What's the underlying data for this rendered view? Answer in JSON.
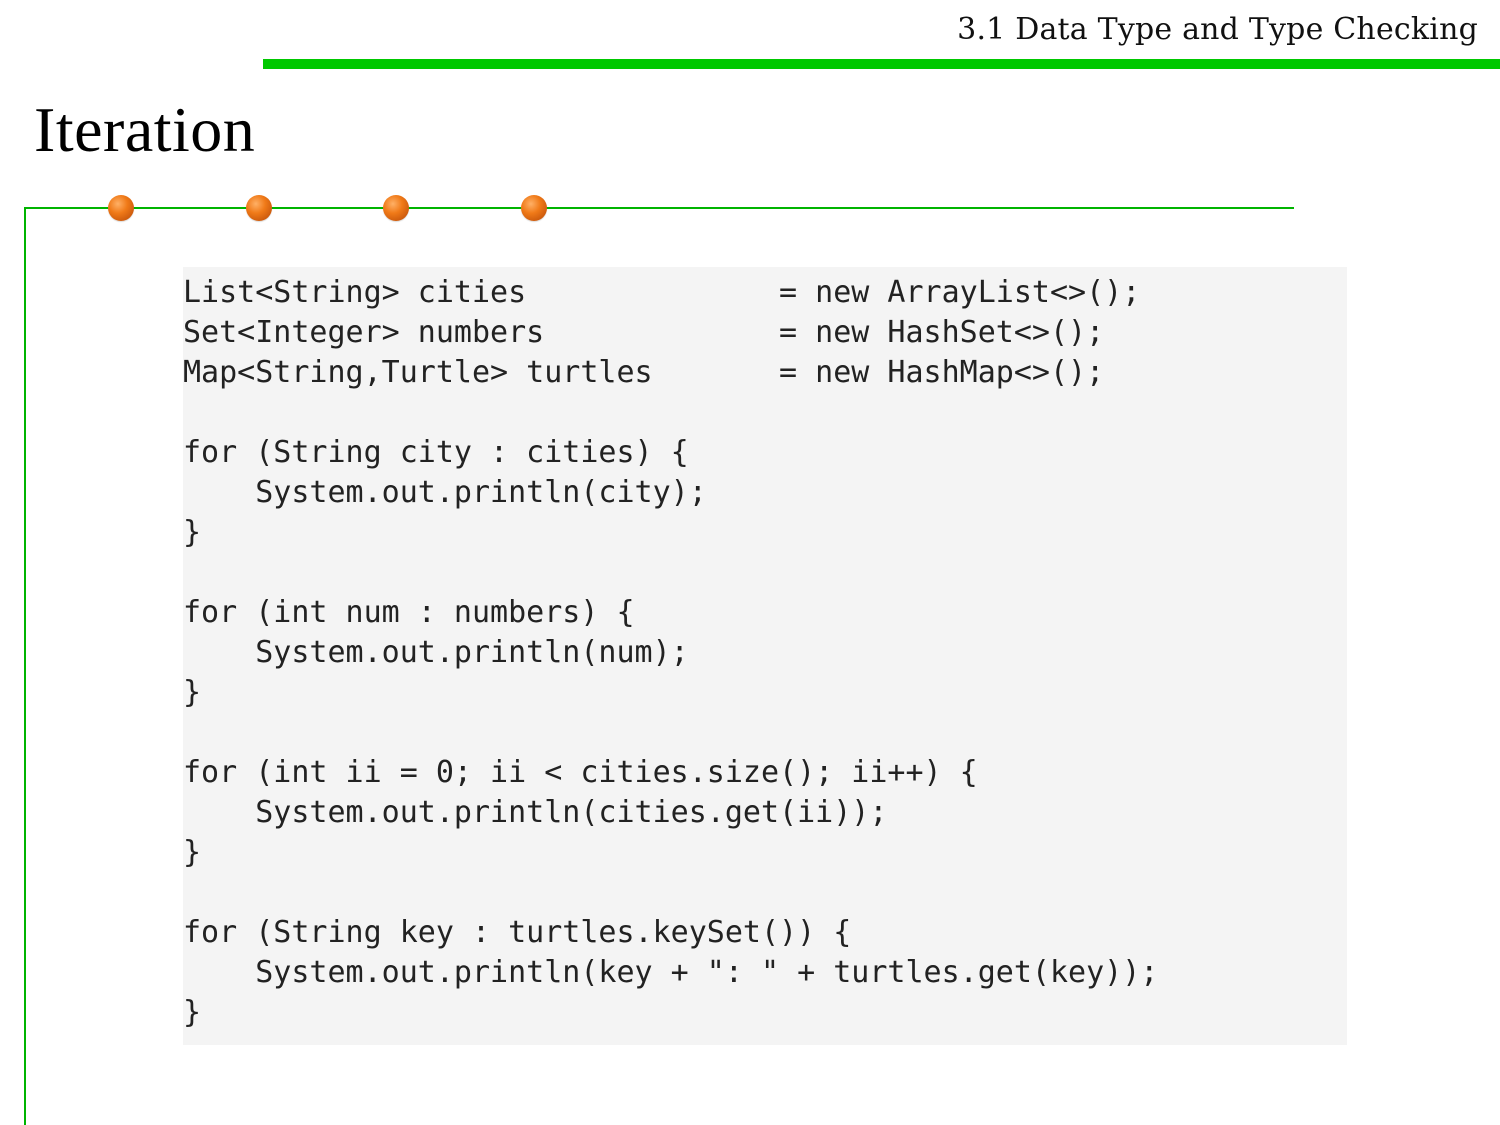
{
  "header": {
    "section_title": "3.1 Data Type and Type Checking"
  },
  "slide": {
    "title": "Iteration"
  },
  "code": {
    "lines": [
      "List<String> cities              = new ArrayList<>();",
      "Set<Integer> numbers             = new HashSet<>();",
      "Map<String,Turtle> turtles       = new HashMap<>();",
      "",
      "for (String city : cities) {",
      "    System.out.println(city);",
      "}",
      "",
      "for (int num : numbers) {",
      "    System.out.println(num);",
      "}",
      "",
      "for (int ii = 0; ii < cities.size(); ii++) {",
      "    System.out.println(cities.get(ii));",
      "}",
      "",
      "for (String key : turtles.keySet()) {",
      "    System.out.println(key + \": \" + turtles.get(key));",
      "}"
    ]
  },
  "colors": {
    "header_rule": "#00c800",
    "frame_line": "#00b400",
    "bullet_dot": "#f07a18",
    "code_background": "#f4f4f4"
  }
}
